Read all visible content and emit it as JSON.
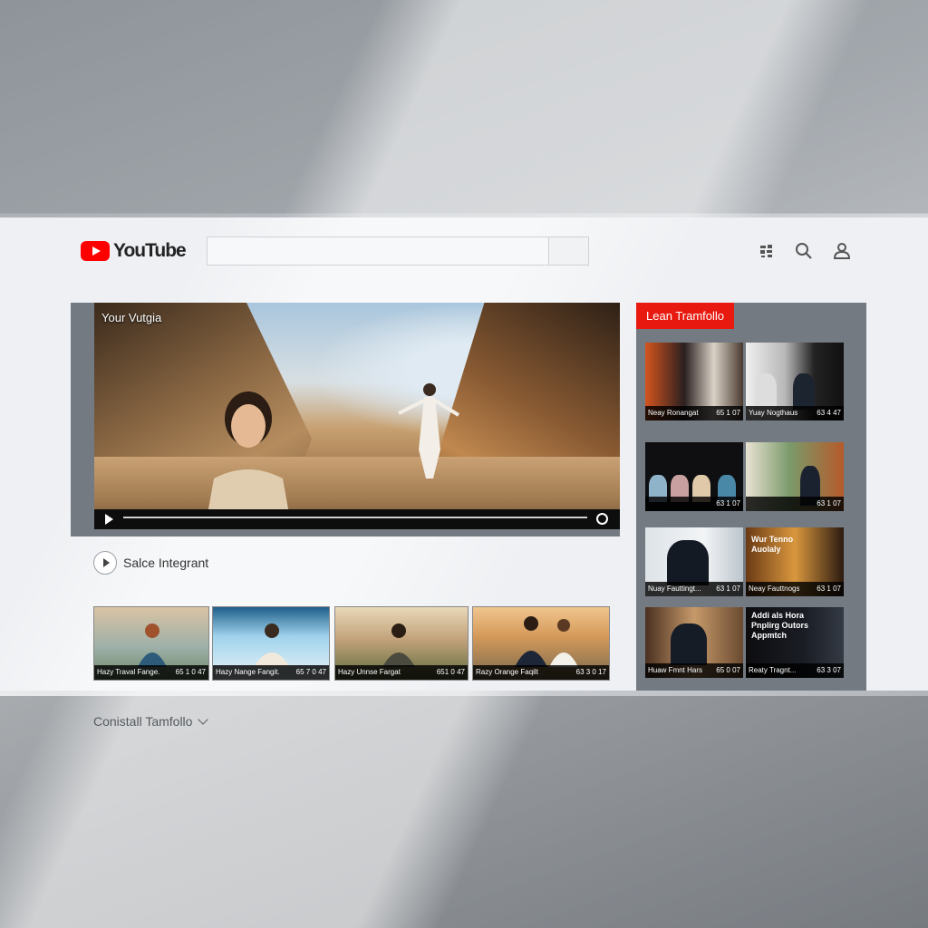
{
  "header": {
    "logo_text": "YouTube",
    "search_placeholder": ""
  },
  "player": {
    "title": "Your Vutgia"
  },
  "channel": {
    "name": "Salce Integrant"
  },
  "related": [
    {
      "title": "Hazy Traval Fange.",
      "meta": "65 1 0 47"
    },
    {
      "title": "Hazy Nange Fangit.",
      "meta": "65 7 0 47"
    },
    {
      "title": "Hazy Unnse Fargat",
      "meta": "651 0 47"
    },
    {
      "title": "Razy Orange Faqilt",
      "meta": "63 3 0 17"
    }
  ],
  "sidebar": {
    "tag": "Lean Tramfollo",
    "items": [
      {
        "title": "Neay Ronangat",
        "meta": "65 1 07"
      },
      {
        "title": "Yuay Nogthaus",
        "meta": "63 4 47"
      },
      {
        "title": "",
        "meta": "63 1 07"
      },
      {
        "title": "",
        "meta": "63 1 07"
      },
      {
        "title": "Nuay Fauttingt...",
        "meta": "63 1 07"
      },
      {
        "title": "Neay Fauttnogs",
        "meta": "63 1 07",
        "overlay": "Wur Tenno Auolaly"
      },
      {
        "title": "Huaw Fmnt Hars",
        "meta": "65 0 07"
      },
      {
        "title": "Reaty Tragnt...",
        "meta": "63 3 07",
        "overlay": "Addi als Hora Pnplirg Outors Appmtch"
      }
    ]
  },
  "footer": {
    "more_label": "Conistall Tamfollo"
  }
}
